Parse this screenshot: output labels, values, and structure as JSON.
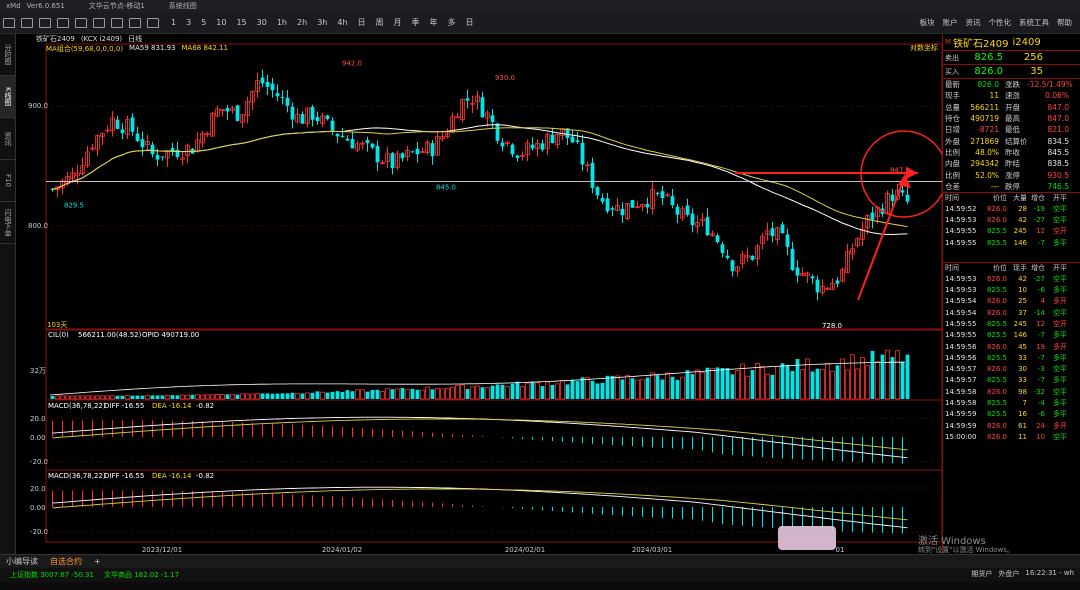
{
  "titlebar": {
    "app": "xMd",
    "version": "Ver6.0.651",
    "menu1": "文华云节点-移动1",
    "menu2": "系统线图"
  },
  "toolbar": {
    "periods": [
      "1",
      "3",
      "5",
      "10",
      "15",
      "30",
      "1h",
      "2h",
      "3h",
      "4h",
      "日",
      "周",
      "月",
      "季",
      "年",
      "多",
      "日"
    ],
    "right": [
      "板块",
      "账户",
      "资讯",
      "个性化",
      "系统工具",
      "帮助"
    ]
  },
  "sidetabs": [
    "分时图",
    "K线图",
    "资讯",
    "F10",
    "闪电下单"
  ],
  "chart_header": {
    "code": "铁矿石2409",
    "tag": "(KCX i2409)",
    "period": "日线"
  },
  "main_indicator": {
    "name": "MA组合(59,68,0,0,0,0)",
    "ma59": "MA59 831.93",
    "ma68": "MA68 842.11",
    "reset": "对数坐标"
  },
  "price_axis": {
    "p900": "900.0",
    "p800": "800.0"
  },
  "annotations": {
    "high1": "942.0",
    "high2": "930.0",
    "mid": "845.0",
    "low_left": "829.5",
    "low": "728.0",
    "recent": "847.0",
    "days": "103天"
  },
  "volume_panel": {
    "title": "CIL(0)",
    "vol": "566211.00(48.52)",
    "oi": "OPID 490719.00",
    "axis": "32万"
  },
  "macd1": {
    "title": "MACD(36,78,22)",
    "diff": "DIFF -16.55",
    "dea": "DEA -16.14",
    "macd": "-0.82",
    "axis": [
      "20.0",
      "0.00",
      "-20.0"
    ]
  },
  "macd2": {
    "title": "MACD(36,78,22)",
    "diff": "DIFF -16.55",
    "dea": "DEA -16.14",
    "macd": "-0.82",
    "axis": [
      "20.0",
      "0.00",
      "-20.0"
    ]
  },
  "dates": [
    "2023/12/01",
    "2024/01/02",
    "2024/02/01",
    "2024/03/01",
    "01"
  ],
  "quote": {
    "name": "铁矿石2409",
    "code": "i2409",
    "sell_label": "卖出",
    "sell_price": "826.5",
    "sell_qty": "256",
    "buy_label": "买入",
    "buy_price": "826.0",
    "buy_qty": "35",
    "rows": [
      [
        "最新",
        "826.0",
        "涨跌",
        "-12.5/1.49%"
      ],
      [
        "现手",
        "11",
        "速涨",
        "0.06%"
      ],
      [
        "总量",
        "566211",
        "开盘",
        "847.0"
      ],
      [
        "持仓",
        "490719",
        "最高",
        "847.0"
      ],
      [
        "日增",
        "-8721",
        "最低",
        "821.0"
      ],
      [
        "外盘",
        "271869",
        "结算价",
        "834.5"
      ],
      [
        "比例",
        "48.0%",
        "昨收",
        "845.5"
      ],
      [
        "内盘",
        "294342",
        "昨结",
        "838.5"
      ],
      [
        "比例",
        "52.0%",
        "涨停",
        "930.5"
      ],
      [
        "仓差",
        "---",
        "跌停",
        "746.5"
      ]
    ]
  },
  "ticks_header": [
    "时间",
    "价位",
    "大量",
    "增仓",
    "开平"
  ],
  "ticks1": [
    [
      "14:59:52",
      "826.0",
      "28",
      "-19",
      "空平"
    ],
    [
      "14:59:53",
      "826.0",
      "42",
      "-27",
      "空平"
    ],
    [
      "14:59:55",
      "825.5",
      "245",
      "12",
      "空开"
    ],
    [
      "14:59:55",
      "825.5",
      "146",
      "-7",
      "多平"
    ]
  ],
  "ticks_header2": [
    "时间",
    "价位",
    "现手",
    "增仓",
    "开平"
  ],
  "ticks2": [
    [
      "14:59:53",
      "826.0",
      "42",
      "-27",
      "空平"
    ],
    [
      "14:59:53",
      "825.5",
      "10",
      "-6",
      "多平"
    ],
    [
      "14:59:54",
      "826.0",
      "25",
      "4",
      "多开"
    ],
    [
      "14:59:54",
      "826.0",
      "37",
      "-14",
      "空平"
    ],
    [
      "14:59:55",
      "825.5",
      "245",
      "12",
      "空开"
    ],
    [
      "14:59:55",
      "825.5",
      "146",
      "-7",
      "多平"
    ],
    [
      "14:59:56",
      "826.0",
      "45",
      "19",
      "多开"
    ],
    [
      "14:59:56",
      "825.5",
      "33",
      "-7",
      "多平"
    ],
    [
      "14:59:57",
      "826.0",
      "30",
      "-3",
      "空平"
    ],
    [
      "14:59:57",
      "825.5",
      "33",
      "-7",
      "多平"
    ],
    [
      "14:59:58",
      "826.0",
      "98",
      "-32",
      "空平"
    ],
    [
      "14:59:58",
      "825.5",
      "7",
      "-4",
      "多平"
    ],
    [
      "14:59:59",
      "825.5",
      "16",
      "-6",
      "多平"
    ],
    [
      "14:59:59",
      "826.0",
      "61",
      "24",
      "多开"
    ],
    [
      "15:00:00",
      "826.0",
      "11",
      "10",
      "空平"
    ]
  ],
  "bottom_tabs": [
    "小编导读",
    "自选合约",
    "+"
  ],
  "status": {
    "idx1": "上证指数 3007.87 -50.31",
    "idx2": "文华商品 182.02 -1.17"
  },
  "status_right": [
    "期货户",
    "外盘户",
    "16:22:31 - wh"
  ],
  "watermark": {
    "line1": "激活 Windows",
    "line2": "转到\"设置\"以激活 Windows。"
  },
  "colors": {
    "up": "#ff3030",
    "down": "#00e5e5",
    "ma59": "#ffffff",
    "ma68": "#e0d040",
    "arrow": "#ff2020"
  }
}
